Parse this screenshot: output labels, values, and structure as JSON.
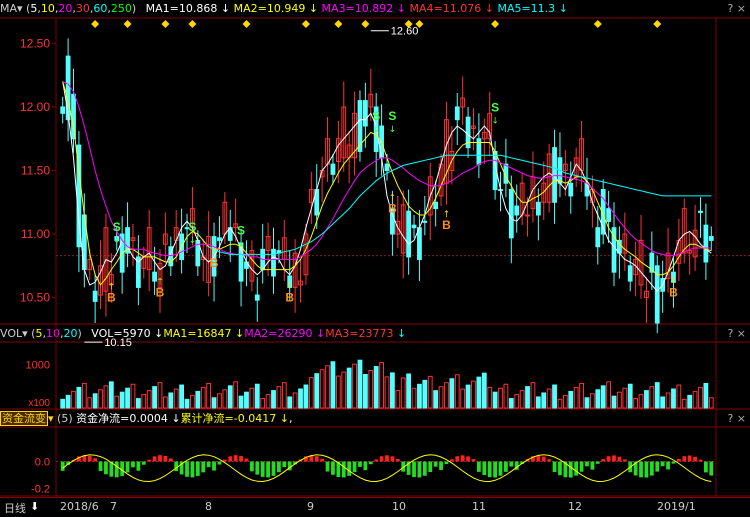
{
  "price_header": {
    "name": "MA",
    "params_prefix": "(",
    "params": [
      "5",
      "10",
      "20",
      "30",
      "60",
      "250"
    ],
    "params_suffix": ")",
    "ma1": "MA1=10.868",
    "ma2": "MA2=10.949",
    "ma3": "MA3=10.892",
    "ma4": "MA4=11.076",
    "ma5": "MA5=11.3",
    "arrow": "↓"
  },
  "vol_header": {
    "name": "VOL",
    "params_prefix": "(",
    "params": [
      "5",
      "10",
      "20"
    ],
    "params_suffix": ")",
    "vol": "VOL=5970",
    "ma1": "MA1=16847",
    "ma2": "MA2=26290",
    "ma3": "MA3=23773",
    "arrow": "↓"
  },
  "flow_header": {
    "name": "资金流变",
    "param": "(5)",
    "net": "资金净流=0.0004",
    "cum": "累计净流=-0.0417",
    "arrow": "↓",
    "tail": ","
  },
  "help_marks": "? ×",
  "bottom_bar": {
    "period": "日线",
    "period_arrow": "⬇",
    "x_labels": [
      "2018/6",
      "7",
      "8",
      "9",
      "10",
      "11",
      "12",
      "2019/1"
    ]
  },
  "colors": {
    "up": "#ff3232",
    "down": "#54ffff",
    "grid": "#800000",
    "ma1": "#ffffff",
    "ma2": "#ffff00",
    "ma3": "#ff00ff",
    "ma4": "#00ff00",
    "ma5": "#00ffff",
    "diamond": "#ffd700",
    "buy": "#ff8c1a",
    "sell": "#44ff44"
  },
  "chart_data": [
    {
      "type": "candlestick",
      "ylim": [
        10.3,
        12.7
      ],
      "y_ticks": [
        "12.50",
        "12.00",
        "11.50",
        "11.00",
        "10.50"
      ],
      "y_tick_values": [
        12.5,
        12.0,
        11.5,
        11.0,
        10.5
      ],
      "annotations": [
        {
          "text": "12.60",
          "value": 12.6,
          "date_index": 57
        },
        {
          "text": "10.15",
          "value": 10.15,
          "date_index": 4
        }
      ],
      "signals": [
        {
          "label": "S",
          "kind": "sell",
          "date_index": 10,
          "value": 11.01
        },
        {
          "label": "B",
          "kind": "buy",
          "date_index": 9,
          "value": 10.58
        },
        {
          "label": "B",
          "kind": "buy",
          "date_index": 18,
          "value": 10.62
        },
        {
          "label": "S",
          "kind": "sell",
          "date_index": 24,
          "value": 11.01
        },
        {
          "label": "B",
          "kind": "buy",
          "date_index": 28,
          "value": 10.85
        },
        {
          "label": "S",
          "kind": "sell",
          "date_index": 33,
          "value": 10.98
        },
        {
          "label": "B",
          "kind": "buy",
          "date_index": 42,
          "value": 10.58
        },
        {
          "label": "S",
          "kind": "sell",
          "date_index": 58,
          "value": 11.88
        },
        {
          "label": "S",
          "kind": "sell",
          "date_index": 61,
          "value": 11.88
        },
        {
          "label": "B",
          "kind": "buy",
          "date_index": 61,
          "value": 11.28
        },
        {
          "label": "B",
          "kind": "buy",
          "date_index": 71,
          "value": 11.15
        },
        {
          "label": "S",
          "kind": "sell",
          "date_index": 80,
          "value": 11.95
        },
        {
          "label": "B",
          "kind": "buy",
          "date_index": 113,
          "value": 10.62
        }
      ],
      "series": [
        {
          "name": "MA1",
          "values": [
            12.2,
            11.95,
            11.6,
            11.1,
            10.72,
            10.6,
            10.62,
            10.7,
            10.8,
            10.78,
            10.85,
            10.95,
            10.9,
            10.82,
            10.78,
            10.82,
            10.85,
            10.78,
            10.72,
            10.75,
            10.85,
            10.95,
            11.05,
            11.1,
            11.05,
            10.95,
            10.82,
            10.78,
            10.82,
            10.9,
            11.0,
            11.05,
            10.98,
            10.88,
            10.78,
            10.72,
            10.68,
            10.72,
            10.78,
            10.82,
            10.8,
            10.72,
            10.68,
            10.75,
            10.88,
            11.05,
            11.2,
            11.35,
            11.5,
            11.55,
            11.62,
            11.7,
            11.75,
            11.8,
            11.85,
            11.9,
            11.9,
            11.95,
            11.85,
            11.6,
            11.3,
            11.15,
            11.05,
            10.98,
            10.92,
            10.95,
            11.05,
            11.15,
            11.3,
            11.4,
            11.55,
            11.7,
            11.8,
            11.85,
            11.82,
            11.78,
            11.75,
            11.8,
            11.85,
            11.8,
            11.55,
            11.35,
            11.2,
            11.12,
            11.1,
            11.15,
            11.25,
            11.35,
            11.4,
            11.45,
            11.48,
            11.45,
            11.4,
            11.35,
            11.45,
            11.55,
            11.5,
            11.4,
            11.25,
            11.15,
            11.05,
            10.95,
            10.9,
            10.85,
            10.8,
            10.78,
            10.75,
            10.7,
            10.65,
            10.6,
            10.55,
            10.6,
            10.7,
            10.82,
            10.95,
            11.0,
            11.02,
            10.98,
            10.92,
            10.88,
            10.85
          ]
        },
        {
          "name": "MA2",
          "values": [
            12.2,
            12.05,
            11.85,
            11.5,
            11.15,
            10.85,
            10.68,
            10.6,
            10.65,
            10.72,
            10.78,
            10.85,
            10.88,
            10.88,
            10.85,
            10.82,
            10.82,
            10.82,
            10.8,
            10.78,
            10.78,
            10.82,
            10.9,
            10.98,
            11.02,
            11.0,
            10.95,
            10.9,
            10.88,
            10.88,
            10.9,
            10.92,
            10.92,
            10.9,
            10.85,
            10.8,
            10.75,
            10.72,
            10.72,
            10.72,
            10.72,
            10.72,
            10.72,
            10.75,
            10.8,
            10.88,
            10.98,
            11.1,
            11.22,
            11.32,
            11.4,
            11.48,
            11.55,
            11.6,
            11.65,
            11.7,
            11.75,
            11.8,
            11.78,
            11.72,
            11.6,
            11.48,
            11.38,
            11.3,
            11.22,
            11.18,
            11.15,
            11.15,
            11.2,
            11.28,
            11.38,
            11.48,
            11.58,
            11.65,
            11.7,
            11.72,
            11.72,
            11.72,
            11.72,
            11.72,
            11.65,
            11.55,
            11.45,
            11.38,
            11.3,
            11.25,
            11.25,
            11.28,
            11.3,
            11.33,
            11.38,
            11.42,
            11.42,
            11.4,
            11.42,
            11.45,
            11.45,
            11.42,
            11.35,
            11.25,
            11.15,
            11.05,
            10.98,
            10.92,
            10.88,
            10.85,
            10.82,
            10.78,
            10.75,
            10.72,
            10.68,
            10.68,
            10.7,
            10.75,
            10.82,
            10.88,
            10.92,
            10.92,
            10.9,
            10.88,
            10.87
          ]
        },
        {
          "name": "MA3",
          "values": [
            12.2,
            12.18,
            12.12,
            12.0,
            11.85,
            11.68,
            11.5,
            11.35,
            11.22,
            11.1,
            11.02,
            10.95,
            10.9,
            10.88,
            10.88,
            10.88,
            10.86,
            10.85,
            10.84,
            10.83,
            10.83,
            10.84,
            10.86,
            10.88,
            10.9,
            10.92,
            10.92,
            10.92,
            10.9,
            10.88,
            10.86,
            10.85,
            10.84,
            10.84,
            10.83,
            10.82,
            10.82,
            10.8,
            10.8,
            10.8,
            10.8,
            10.8,
            10.8,
            10.8,
            10.82,
            10.85,
            10.88,
            10.92,
            10.98,
            11.05,
            11.12,
            11.2,
            11.28,
            11.35,
            11.42,
            11.48,
            11.52,
            11.55,
            11.58,
            11.6,
            11.6,
            11.58,
            11.55,
            11.52,
            11.48,
            11.45,
            11.42,
            11.4,
            11.38,
            11.38,
            11.38,
            11.4,
            11.42,
            11.45,
            11.48,
            11.5,
            11.52,
            11.55,
            11.57,
            11.58,
            11.58,
            11.56,
            11.54,
            11.52,
            11.5,
            11.48,
            11.46,
            11.45,
            11.44,
            11.44,
            11.45,
            11.46,
            11.46,
            11.45,
            11.44,
            11.43,
            11.42,
            11.4,
            11.36,
            11.32,
            11.28,
            11.22,
            11.16,
            11.1,
            11.05,
            11.0,
            10.96,
            10.93,
            10.9,
            10.87,
            10.85,
            10.84,
            10.83,
            10.83,
            10.84,
            10.86,
            10.88,
            10.89,
            10.89,
            10.89,
            10.89
          ]
        },
        {
          "name": "MA4",
          "values": [
            null,
            null,
            null,
            null,
            null,
            null,
            null,
            null,
            null,
            null,
            null,
            null,
            null,
            null,
            null,
            null,
            null,
            null,
            null,
            null,
            null,
            null,
            null,
            null,
            null,
            null,
            null,
            null,
            null,
            null,
            null,
            null,
            null,
            null,
            null,
            null,
            null,
            null,
            null,
            null,
            null,
            null,
            null,
            null,
            null,
            null,
            null,
            null,
            null,
            null,
            null,
            null,
            null,
            null,
            null,
            null,
            null,
            null,
            null,
            null,
            null,
            null,
            null,
            null,
            null,
            null,
            null,
            null,
            null,
            null,
            null,
            null,
            null,
            null,
            null,
            null,
            null,
            null,
            null,
            null,
            null,
            null,
            null,
            null,
            null,
            null,
            null,
            null,
            null,
            null,
            null,
            null,
            null,
            null,
            null,
            null,
            null,
            null,
            null,
            null,
            null,
            null,
            null,
            null,
            null,
            null,
            null,
            null,
            null,
            null,
            null,
            null,
            null,
            null,
            null,
            null,
            null,
            null,
            null,
            null,
            null
          ]
        },
        {
          "name": "MA5",
          "values": [
            null,
            null,
            null,
            null,
            null,
            null,
            null,
            null,
            null,
            null,
            null,
            null,
            null,
            null,
            null,
            null,
            null,
            null,
            null,
            null,
            null,
            null,
            null,
            null,
            null,
            null,
            null,
            10.9,
            10.88,
            10.86,
            10.85,
            10.84,
            10.84,
            10.84,
            10.84,
            10.84,
            10.84,
            10.84,
            10.84,
            10.84,
            10.85,
            10.86,
            10.87,
            10.88,
            10.9,
            10.92,
            10.94,
            10.97,
            11.0,
            11.04,
            11.08,
            11.12,
            11.16,
            11.2,
            11.25,
            11.3,
            11.34,
            11.38,
            11.42,
            11.45,
            11.48,
            11.5,
            11.52,
            11.54,
            11.55,
            11.56,
            11.57,
            11.58,
            11.59,
            11.6,
            11.61,
            11.62,
            11.62,
            11.62,
            11.62,
            11.62,
            11.62,
            11.62,
            11.62,
            11.62,
            11.62,
            11.62,
            11.61,
            11.6,
            11.59,
            11.58,
            11.57,
            11.56,
            11.55,
            11.54,
            11.53,
            11.52,
            11.5,
            11.48,
            11.47,
            11.46,
            11.45,
            11.44,
            11.43,
            11.42,
            11.41,
            11.4,
            11.39,
            11.38,
            11.37,
            11.36,
            11.35,
            11.34,
            11.33,
            11.32,
            11.31,
            11.3,
            11.3,
            11.3,
            11.3,
            11.3,
            11.3,
            11.3,
            11.3,
            11.3,
            11.3
          ]
        }
      ]
    },
    {
      "type": "bar",
      "ylim": [
        0,
        90000
      ],
      "y_ticks": [
        "1000"
      ],
      "y_tick_values": [
        60000
      ],
      "unit_label": "x100",
      "note": "volume bars"
    },
    {
      "type": "bar",
      "ylim": [
        -0.25,
        0.25
      ],
      "y_ticks": [
        "0.0",
        "-0.2"
      ],
      "y_tick_values": [
        0.0,
        -0.2
      ],
      "note": "fund flow oscillator"
    }
  ]
}
